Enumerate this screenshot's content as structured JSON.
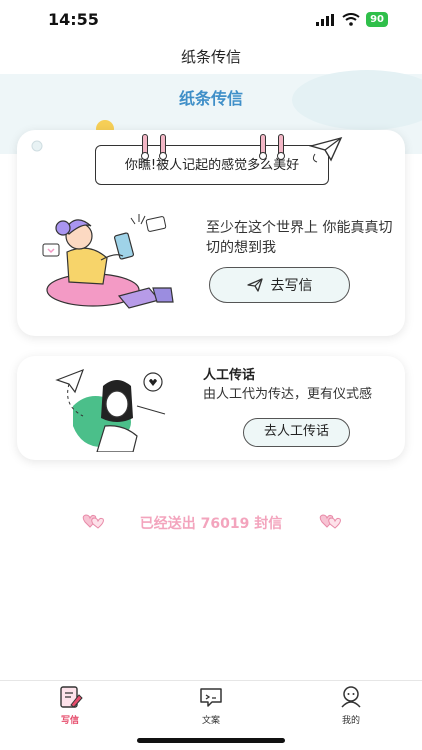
{
  "status_bar": {
    "time": "14:55",
    "battery": "90",
    "icons": [
      "signal-icon",
      "wifi-icon",
      "battery-icon"
    ]
  },
  "nav": {
    "title": "纸条传信"
  },
  "hero": {
    "title": "纸条传信"
  },
  "main_card": {
    "note": "你瞧!被人记起的感觉多么美好",
    "description": "至少在这个世界上 你能真真切切的想到我",
    "write_button": "去写信"
  },
  "human_card": {
    "title": "人工传话",
    "description": "由人工代为传达，更有仪式感",
    "button": "去人工传话"
  },
  "sent": {
    "text": "已经送出 76019 封信"
  },
  "tabbar": {
    "tabs": [
      {
        "label": "写信",
        "icon": "write-letter-icon",
        "active": true
      },
      {
        "label": "文案",
        "icon": "message-icon",
        "active": false
      },
      {
        "label": "我的",
        "icon": "profile-icon",
        "active": false
      }
    ]
  },
  "colors": {
    "accent_blue": "#3f8fc8",
    "accent_pink": "#f3a4bd",
    "active_tab": "#e64b6b",
    "button_fill": "#eef7f7"
  }
}
